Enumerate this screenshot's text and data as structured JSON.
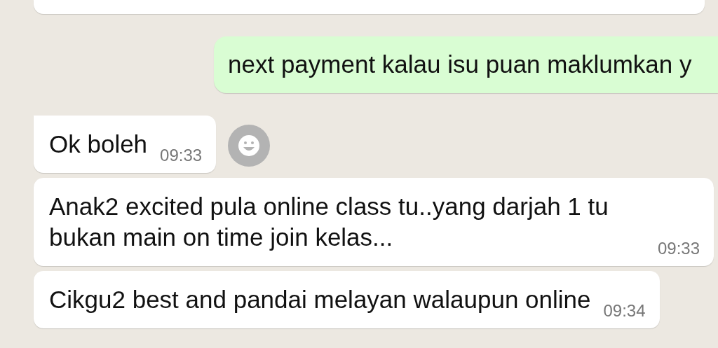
{
  "messages": [
    {
      "kind": "outgoing",
      "text": "next payment kalau isu puan maklumkan y"
    },
    {
      "kind": "incoming",
      "text": "Ok boleh",
      "time": "09:33",
      "reaction_button": true
    },
    {
      "kind": "incoming",
      "text": "Anak2 excited pula online class tu..yang darjah 1 tu bukan main on time join kelas...",
      "time": "09:33",
      "reaction_button": false
    },
    {
      "kind": "incoming",
      "text": "Cikgu2 best and pandai melayan walaupun online",
      "time": "09:34",
      "reaction_button": false
    }
  ]
}
